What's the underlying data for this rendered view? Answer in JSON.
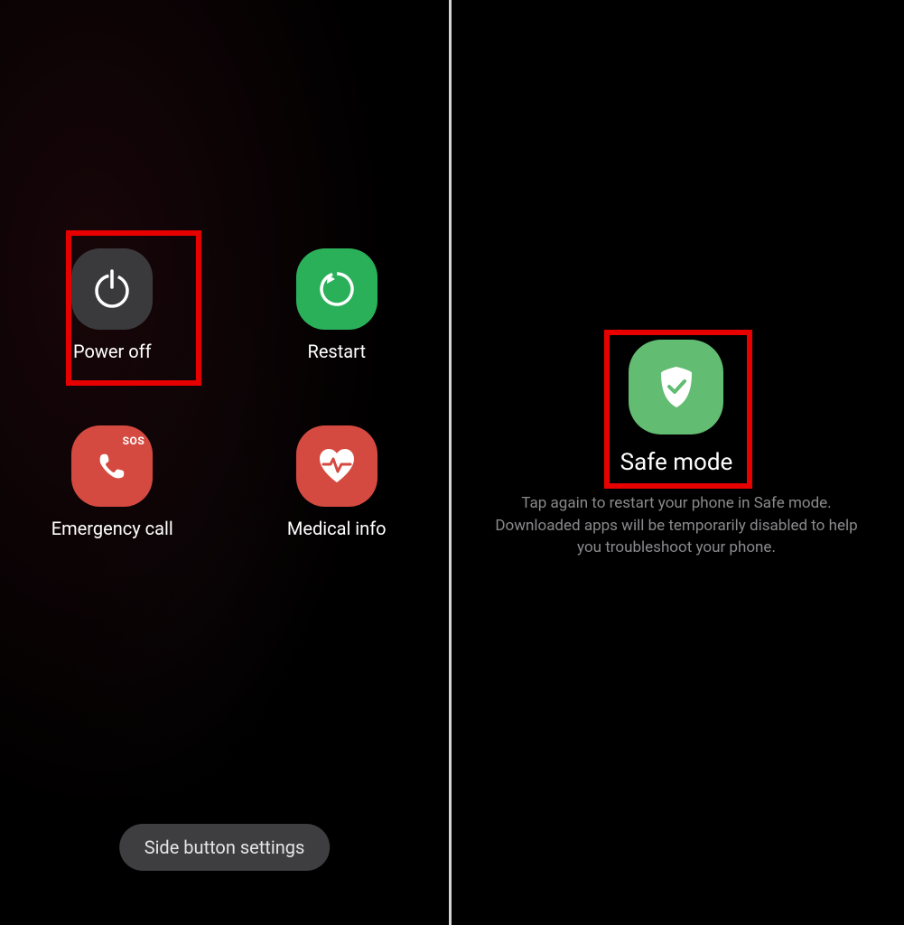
{
  "power_menu": {
    "power_off": {
      "label": "Power off"
    },
    "restart": {
      "label": "Restart"
    },
    "emergency_call": {
      "label": "Emergency call",
      "badge": "SOS"
    },
    "medical_info": {
      "label": "Medical info"
    }
  },
  "bottom_button": {
    "label": "Side button settings"
  },
  "safe_mode": {
    "title": "Safe mode",
    "description": "Tap again to restart your phone in Safe mode. Downloaded apps will be temporarily disabled to help you troubleshoot your phone."
  }
}
